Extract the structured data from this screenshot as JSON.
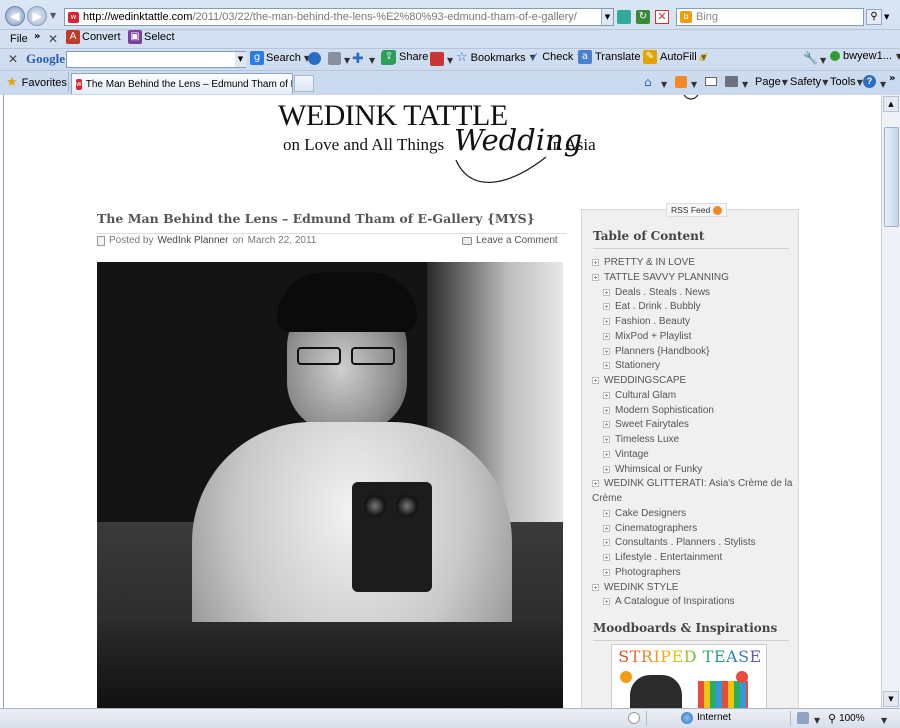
{
  "browser": {
    "address_url_host": "http://wedinktattle.com",
    "address_url_path": "/2011/03/22/the-man-behind-the-lens-%E2%80%93-edmund-tham-of-e-gallery/",
    "search_placeholder": "Bing",
    "menu_file": "File",
    "convert_label": "Convert",
    "select_label": "Select",
    "google_label": "Google",
    "google_search_label": "Search",
    "share_label": "Share",
    "bookmarks_label": "Bookmarks",
    "check_label": "Check",
    "translate_label": "Translate",
    "autofill_label": "AutoFill",
    "user_label": "bwyew1...",
    "favorites_label": "Favorites",
    "tab_title": "The Man Behind the Lens – Edmund Tham of E-Gallery...",
    "page_menu": "Page",
    "safety_menu": "Safety",
    "tools_menu": "Tools",
    "status_zone": "Internet",
    "zoom": "100%"
  },
  "site": {
    "title": "WEDINK TATTLE",
    "tagline_pre": "on Love and All Things",
    "tagline_script": "Wedding",
    "tagline_post": "in Asia"
  },
  "post": {
    "title": "The Man Behind the Lens – Edmund Tham of E-Gallery {MYS}",
    "posted_by": "Posted by",
    "author": "WedInk Planner",
    "on_label": "on",
    "date": "March 22, 2011",
    "comment_link": "Leave a Comment"
  },
  "sidebar": {
    "rss": "RSS Feed",
    "toc_heading": "Table of Content",
    "toc": [
      {
        "label": "PRETTY & IN LOVE",
        "level": 0
      },
      {
        "label": "TATTLE SAVVY PLANNING",
        "level": 0
      },
      {
        "label": "Deals . Steals . News",
        "level": 1
      },
      {
        "label": "Eat . Drink . Bubbly",
        "level": 1
      },
      {
        "label": "Fashion . Beauty",
        "level": 1
      },
      {
        "label": "MixPod + Playlist",
        "level": 1
      },
      {
        "label": "Planners {Handbook}",
        "level": 1
      },
      {
        "label": "Stationery",
        "level": 1
      },
      {
        "label": "WEDDINGSCAPE",
        "level": 0
      },
      {
        "label": "Cultural Glam",
        "level": 1
      },
      {
        "label": "Modern Sophistication",
        "level": 1
      },
      {
        "label": "Sweet Fairytales",
        "level": 1
      },
      {
        "label": "Timeless Luxe",
        "level": 1
      },
      {
        "label": "Vintage",
        "level": 1
      },
      {
        "label": "Whimsical or Funky",
        "level": 1
      },
      {
        "label": "WEDINK GLITTERATI: Asia's Crème de la",
        "level": 0
      },
      {
        "label": "Crème",
        "level": 0
      },
      {
        "label": "Cake Designers",
        "level": 1
      },
      {
        "label": "Cinematographers",
        "level": 1
      },
      {
        "label": "Consultants . Planners . Stylists",
        "level": 1
      },
      {
        "label": "Lifestyle . Entertainment",
        "level": 1
      },
      {
        "label": "Photographers",
        "level": 1
      },
      {
        "label": "WEDINK STYLE",
        "level": 0
      },
      {
        "label": "A Catalogue of Inspirations",
        "level": 1
      }
    ],
    "moodboards_heading": "Moodboards & Inspirations",
    "striped_tease": "STRIPED TEASE"
  }
}
